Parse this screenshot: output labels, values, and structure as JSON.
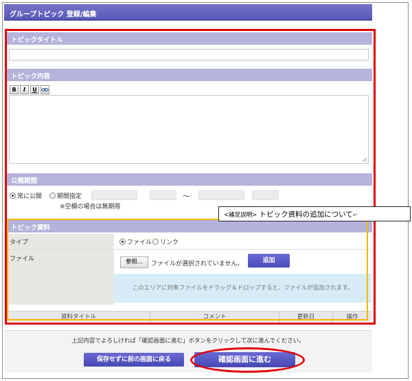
{
  "header": {
    "title": "グループトピック 登録/編集"
  },
  "sections": {
    "topic_title": {
      "label": "トピックタイトル",
      "value": ""
    },
    "topic_content": {
      "label": "トピック内容",
      "toolbar": {
        "bold": "B",
        "italic": "I",
        "underline": "U"
      },
      "value": ""
    },
    "publish_period": {
      "label": "公開期間",
      "always_label": "常に公開",
      "period_label": "期間指定",
      "note": "※空欄の場合は無期限",
      "separator": "～"
    },
    "materials": {
      "label": "トピック資料",
      "type_label": "タイプ",
      "type_file": "ファイル",
      "type_link": "リンク",
      "file_label": "ファイル",
      "browse_label": "参照...",
      "no_file_text": "ファイルが選択されていません。",
      "add_label": "追加",
      "drop_text": "このエリアに対象ファイルをドラッグ＆ドロップすると、ファイルが追加されます。",
      "columns": [
        "資料タイトル",
        "コメント",
        "更新日",
        "操作"
      ]
    }
  },
  "callout": {
    "prefix": "<補足説明>",
    "text": "トピック資料の追加について",
    "mark": "↵"
  },
  "footer": {
    "message": "上記内容でよろしければ「確認画面に進む」ボタンをクリックして次に進んでください。",
    "back_label": "保存せずに前の画面に戻る",
    "confirm_label": "確認画面に進む"
  }
}
